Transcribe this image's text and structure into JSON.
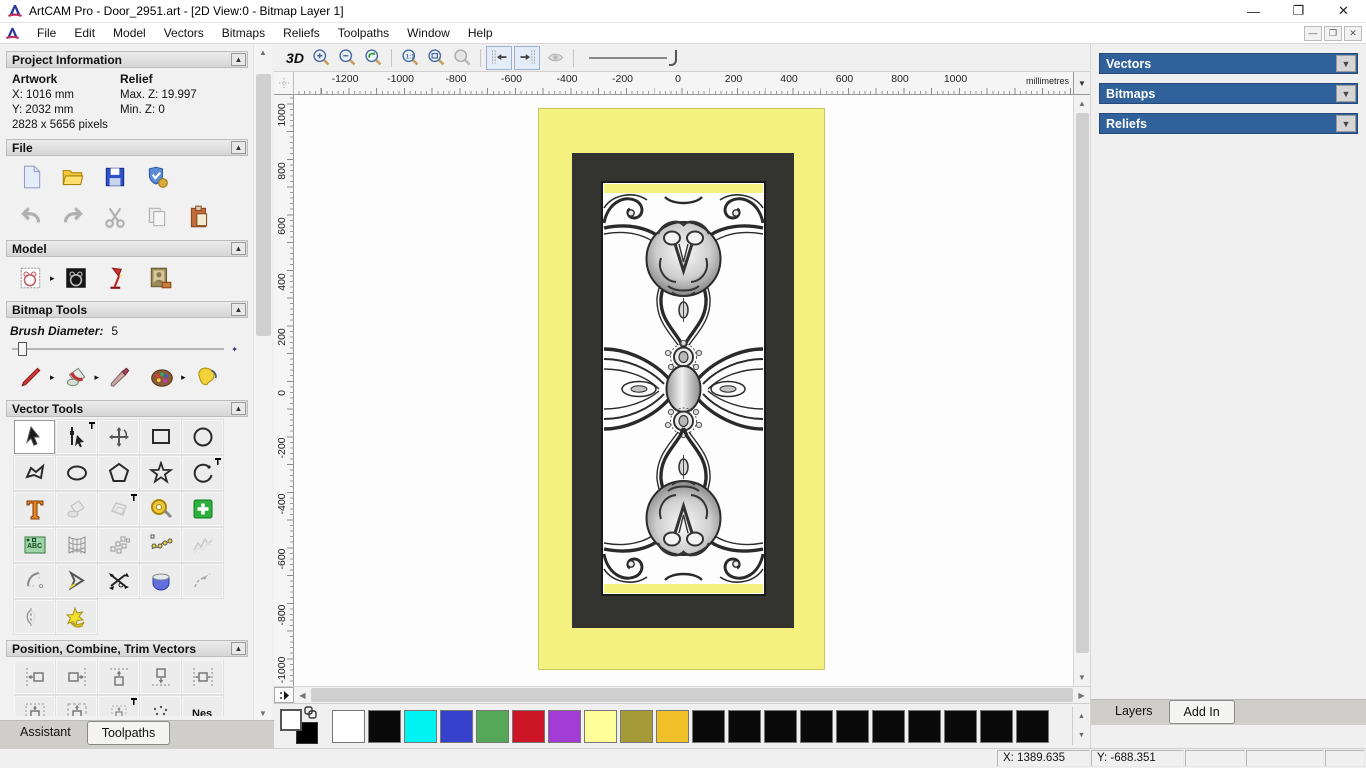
{
  "window": {
    "title": "ArtCAM Pro - Door_2951.art - [2D View:0 - Bitmap Layer 1]",
    "controls": {
      "minimize": "—",
      "restore": "❐",
      "close": "✕"
    }
  },
  "menu": {
    "items": [
      "File",
      "Edit",
      "Model",
      "Vectors",
      "Bitmaps",
      "Reliefs",
      "Toolpaths",
      "Window",
      "Help"
    ],
    "mdi_controls": {
      "minimize": "—",
      "restore": "❐",
      "close": "✕"
    }
  },
  "assistant": {
    "tabs": [
      {
        "label": "Assistant",
        "active": true
      },
      {
        "label": "Toolpaths",
        "active": false
      }
    ],
    "sections": {
      "project": {
        "title": "Project Information",
        "artwork_label": "Artwork",
        "relief_label": "Relief",
        "x": "X: 1016 mm",
        "y": "Y: 2032 mm",
        "pixels": "2828 x 5656 pixels",
        "max_z": "Max. Z: 19.997",
        "min_z": "Min. Z: 0"
      },
      "file": {
        "title": "File",
        "row1": [
          "new-file-icon",
          "open-file-icon",
          "save-file-icon",
          "import-export-icon"
        ],
        "row2": [
          "undo-icon",
          "redo-icon",
          "cut-icon",
          "copy-icon",
          "paste-icon"
        ]
      },
      "model": {
        "title": "Model",
        "row": [
          {
            "icon": "model-sketch-icon",
            "flyout": true
          },
          {
            "icon": "relief-preview-icon"
          },
          {
            "icon": "light-material-icon"
          },
          {
            "icon": "texture-relief-icon"
          }
        ]
      },
      "bitmap": {
        "title": "Bitmap Tools",
        "brush_label": "Brush Diameter:",
        "brush_value": "5",
        "row": [
          {
            "icon": "paint-brush-icon",
            "flyout": true
          },
          {
            "icon": "paint-bucket-icon",
            "flyout": true
          },
          {
            "icon": "eyedropper-icon"
          },
          {
            "icon": "palette-icon",
            "flyout": true
          },
          {
            "icon": "flood-fill-icon"
          }
        ]
      },
      "vector": {
        "title": "Vector Tools",
        "grid": [
          {
            "icon": "select-arrow-icon",
            "active": true
          },
          {
            "icon": "node-edit-icon",
            "pin": true
          },
          {
            "icon": "transform-icon"
          },
          {
            "icon": "rectangle-tool-icon"
          },
          {
            "icon": "circle-tool-icon"
          },
          {
            "icon": "polyline-tool-icon"
          },
          {
            "icon": "ellipse-tool-icon"
          },
          {
            "icon": "polygon-tool-icon"
          },
          {
            "icon": "star-tool-icon"
          },
          {
            "icon": "arc-tool-icon",
            "pin": true
          },
          {
            "icon": "text-tool-icon"
          },
          {
            "icon": "pour-vector-icon"
          },
          {
            "icon": "offset-vector-icon",
            "pin": true
          },
          {
            "icon": "measure-icon"
          },
          {
            "icon": "paste-vectors-icon"
          },
          {
            "icon": "text-block-icon"
          },
          {
            "icon": "distort-grid-icon"
          },
          {
            "icon": "block-copy-icon"
          },
          {
            "icon": "curve-points-icon"
          },
          {
            "icon": "fit-curve-icon"
          },
          {
            "icon": "fillet-arc-icon"
          },
          {
            "icon": "chevron-tool-icon"
          },
          {
            "icon": "trim-vectors-icon"
          },
          {
            "icon": "extrude-icon"
          },
          {
            "icon": "join-curve-icon"
          },
          {
            "icon": "mirror-half-icon"
          },
          {
            "icon": "wrap-star-icon"
          }
        ]
      },
      "position": {
        "title": "Position, Combine, Trim Vectors",
        "grid": [
          {
            "icon": "align-left-icon"
          },
          {
            "icon": "align-right-icon"
          },
          {
            "icon": "align-top-icon"
          },
          {
            "icon": "align-bottom-icon"
          },
          {
            "icon": "center-horizontal-icon"
          },
          {
            "icon": "center-in-page-icon"
          },
          {
            "icon": "center-in-page2-icon"
          },
          {
            "icon": "center-small-icon",
            "pin": true
          },
          {
            "icon": "scatter-copies-icon"
          },
          {
            "icon": "nest-vectors-icon"
          }
        ]
      }
    }
  },
  "toolbar": {
    "view_3d": "3D",
    "icons": [
      {
        "icon": "zoom-in-icon"
      },
      {
        "icon": "zoom-out-icon"
      },
      {
        "icon": "zoom-previous-icon"
      },
      {
        "sep": true
      },
      {
        "icon": "zoom-1to1-icon"
      },
      {
        "icon": "zoom-fit-icon"
      },
      {
        "icon": "zoom-object-icon"
      },
      {
        "sep": true
      },
      {
        "icon": "snap-prev-icon",
        "toggled": true
      },
      {
        "icon": "snap-next-icon",
        "toggled": true
      },
      {
        "icon": "contrast-icon"
      },
      {
        "sep": true
      }
    ]
  },
  "ruler": {
    "units": "millimetres",
    "h_labels": [
      -1200,
      -1000,
      -800,
      -600,
      -400,
      -200,
      0,
      200,
      400,
      600,
      800,
      1000
    ],
    "v_labels": [
      1000,
      800,
      600,
      400,
      200,
      0,
      -200,
      -400,
      -600,
      -800,
      -1000
    ]
  },
  "right_panel": {
    "headers": [
      "Vectors",
      "Bitmaps",
      "Reliefs"
    ],
    "tabs": [
      {
        "label": "Layers",
        "active": true
      },
      {
        "label": "Add In",
        "active": false
      }
    ]
  },
  "palette": {
    "colors": [
      "#ffffff",
      "#0a0a0a",
      "#00f2f2",
      "#3642cc",
      "#55a857",
      "#cc1628",
      "#a23cd4",
      "#ffff9c",
      "#a59a38",
      "#f0c028",
      "#0a0a0a",
      "#0a0a0a",
      "#0a0a0a",
      "#0a0a0a",
      "#0a0a0a",
      "#0a0a0a",
      "#0a0a0a",
      "#0a0a0a",
      "#0a0a0a",
      "#0a0a0a"
    ]
  },
  "status": {
    "x": "X: 1389.635",
    "y": "Y: -688.351"
  },
  "accents": {
    "panel_header_blue": "#31619b",
    "artwork_yellow": "#f5f180",
    "artwork_dark": "#333330"
  }
}
